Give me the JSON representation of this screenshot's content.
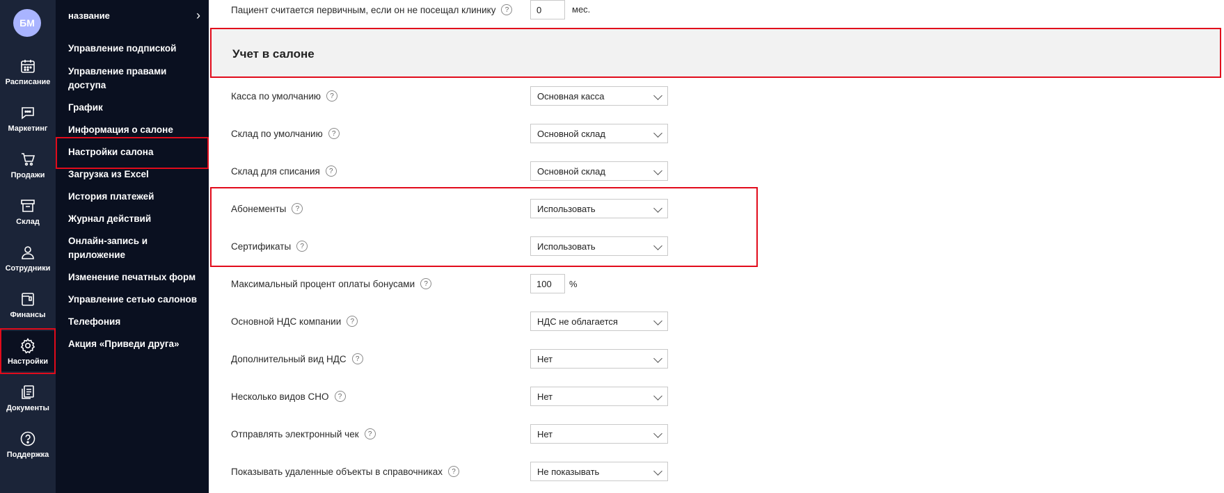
{
  "rail": {
    "avatar": "БМ",
    "items": [
      {
        "label": "Расписание",
        "icon": "calendar-icon"
      },
      {
        "label": "Маркетинг",
        "icon": "chat-icon"
      },
      {
        "label": "Продажи",
        "icon": "cart-icon"
      },
      {
        "label": "Склад",
        "icon": "box-icon"
      },
      {
        "label": "Сотрудники",
        "icon": "person-icon"
      },
      {
        "label": "Финансы",
        "icon": "wallet-icon"
      },
      {
        "label": "Настройки",
        "icon": "gear-icon"
      },
      {
        "label": "Документы",
        "icon": "documents-icon"
      },
      {
        "label": "Поддержка",
        "icon": "help-icon"
      }
    ]
  },
  "menu": {
    "header": "название",
    "items": [
      "Управление подпиской",
      "Управление правами доступа",
      "График",
      "Информация о салоне",
      "Настройки салона",
      "Загрузка из Excel",
      "История платежей",
      "Журнал действий",
      "Онлайн-запись и приложение",
      "Изменение печатных форм",
      "Управление сетью салонов",
      "Телефония",
      "Акция «Приведи друга»"
    ]
  },
  "main": {
    "top_row": {
      "label": "Пациент считается первичным, если он не посещал клинику",
      "value": "0",
      "unit": "мес."
    },
    "section_title": "Учет в салоне",
    "rows": [
      {
        "label": "Касса по умолчанию",
        "value": "Основная касса"
      },
      {
        "label": "Склад по умолчанию",
        "value": "Основной склад"
      },
      {
        "label": "Склад для списания",
        "value": "Основной склад"
      },
      {
        "label": "Абонементы",
        "value": "Использовать"
      },
      {
        "label": "Сертификаты",
        "value": "Использовать"
      },
      {
        "label": "Максимальный процент оплаты бонусами",
        "value": "100",
        "unit": "%"
      },
      {
        "label": "Основной НДС компании",
        "value": "НДС не облагается"
      },
      {
        "label": "Дополнительный вид НДС",
        "value": "Нет"
      },
      {
        "label": "Несколько видов СНО",
        "value": "Нет"
      },
      {
        "label": "Отправлять электронный чек",
        "value": "Нет"
      },
      {
        "label": "Показывать удаленные объекты в справочниках",
        "value": "Не показывать"
      }
    ]
  },
  "colors": {
    "rail_bg": "#1b2438",
    "menu_bg": "#0a1020",
    "highlight": "#e10b1b",
    "avatar": "#a9b4ff"
  }
}
